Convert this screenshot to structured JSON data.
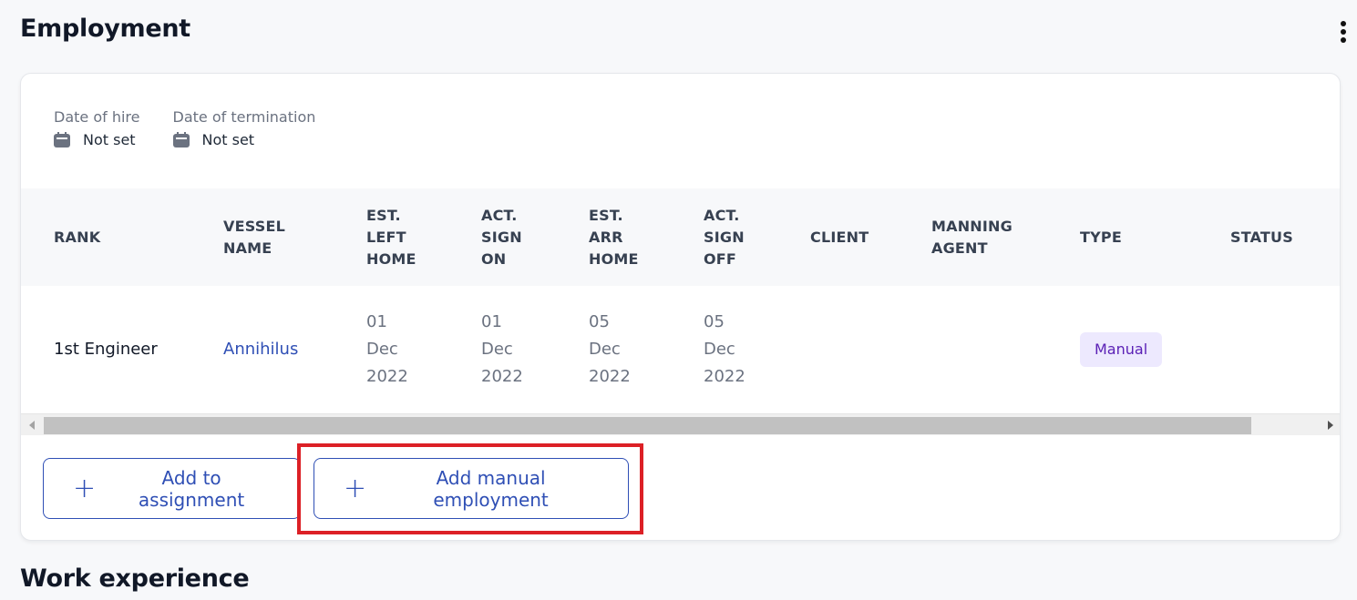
{
  "section": {
    "title": "Employment",
    "menu_icon": "more-vertical-icon"
  },
  "dates": {
    "hire": {
      "label": "Date of hire",
      "value": "Not set",
      "icon": "calendar-icon"
    },
    "termination": {
      "label": "Date of termination",
      "value": "Not set",
      "icon": "calendar-icon"
    }
  },
  "table": {
    "columns": [
      {
        "key": "rank",
        "label": "RANK"
      },
      {
        "key": "vessel",
        "label": "VESSEL NAME"
      },
      {
        "key": "est_left_home",
        "label": "EST. LEFT HOME"
      },
      {
        "key": "act_sign_on",
        "label": "ACT. SIGN ON"
      },
      {
        "key": "est_arr_home",
        "label": "EST. ARR HOME"
      },
      {
        "key": "act_sign_off",
        "label": "ACT. SIGN OFF"
      },
      {
        "key": "client",
        "label": "CLIENT"
      },
      {
        "key": "manning_agent",
        "label": "MANNING AGENT"
      },
      {
        "key": "type",
        "label": "TYPE"
      },
      {
        "key": "status",
        "label": "STATUS"
      }
    ],
    "rows": [
      {
        "rank": "1st Engineer",
        "vessel": "Annihilus",
        "est_left_home": "01 Dec 2022",
        "act_sign_on": "01 Dec 2022",
        "est_arr_home": "05 Dec 2022",
        "act_sign_off": "05 Dec 2022",
        "client": "",
        "manning_agent": "",
        "type": "Manual",
        "status": ""
      }
    ]
  },
  "actions": {
    "add_to_assignment": "Add to assignment",
    "add_manual_employment": "Add manual employment"
  },
  "next_section": {
    "title": "Work experience"
  },
  "colors": {
    "link": "#2f4fb5",
    "badge_bg": "#ede9fe",
    "badge_text": "#5b21b6",
    "highlight": "#dc2026"
  }
}
